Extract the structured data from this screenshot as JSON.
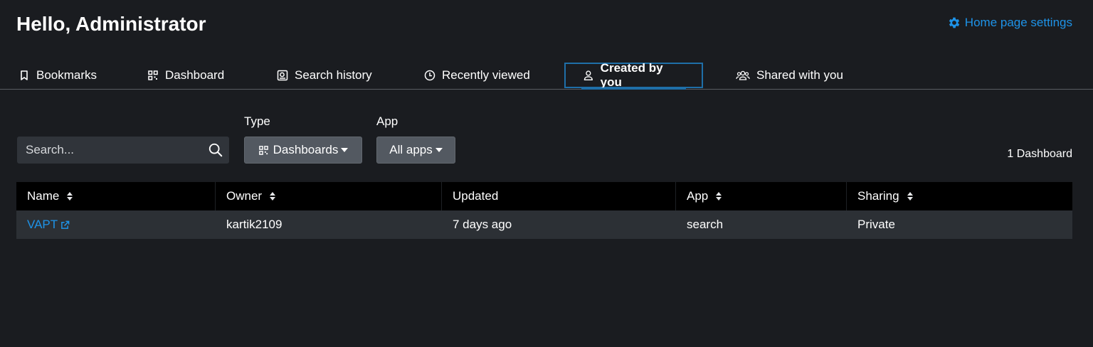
{
  "header": {
    "greeting": "Hello, Administrator",
    "settings_label": "Home page settings"
  },
  "tabs": [
    {
      "label": "Bookmarks",
      "icon": "bookmark-icon"
    },
    {
      "label": "Dashboard",
      "icon": "dashboard-icon"
    },
    {
      "label": "Search history",
      "icon": "search-history-icon"
    },
    {
      "label": "Recently viewed",
      "icon": "clock-icon"
    },
    {
      "label": "Created by you",
      "icon": "user-icon",
      "active": true
    },
    {
      "label": "Shared with you",
      "icon": "users-icon"
    }
  ],
  "filters": {
    "search_placeholder": "Search...",
    "type_label": "Type",
    "type_value": "Dashboards",
    "app_label": "App",
    "app_value": "All apps"
  },
  "result_count": "1 Dashboard",
  "table": {
    "columns": [
      "Name",
      "Owner",
      "Updated",
      "App",
      "Sharing"
    ],
    "rows": [
      {
        "name": "VAPT",
        "owner": "kartik2109",
        "updated": "7 days ago",
        "app": "search",
        "sharing": "Private"
      }
    ]
  },
  "colors": {
    "background": "#1a1c20",
    "accent": "#1e93e8",
    "active_tab_border": "#1f6fa8",
    "header_row": "#000000",
    "data_row": "#2c3035"
  }
}
